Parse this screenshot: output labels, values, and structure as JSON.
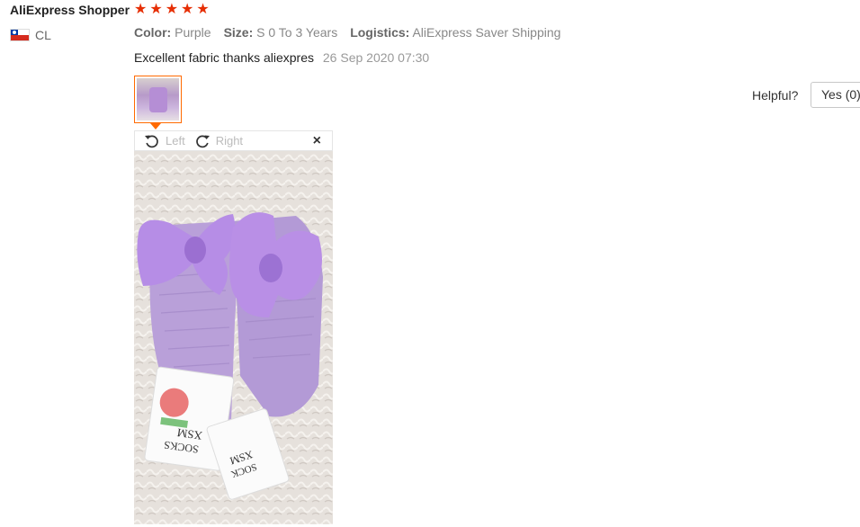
{
  "review": {
    "user_name": "AliExpress Shopper",
    "country_code": "CL",
    "rating_stars": 5,
    "attributes": [
      {
        "key": "Color:",
        "value": "Purple"
      },
      {
        "key": "Size:",
        "value": "S 0 To 3 Years"
      },
      {
        "key": "Logistics:",
        "value": "AliExpress Saver Shipping"
      }
    ],
    "text": "Excellent fabric thanks aliexpres",
    "date": "26 Sep 2020 07:30"
  },
  "viewer": {
    "rotate_left_label": "Left",
    "rotate_right_label": "Right",
    "close_symbol": "×"
  },
  "feedback": {
    "helpful_label": "Helpful?",
    "yes_label": "Yes (0)"
  },
  "colors": {
    "star": "#e62e04",
    "thumb_border": "#ff6a00",
    "sock_purple": "#b58ed5"
  },
  "icons": [
    "chile-flag-icon",
    "star-icon",
    "rotate-left-icon",
    "rotate-right-icon",
    "close-icon"
  ]
}
